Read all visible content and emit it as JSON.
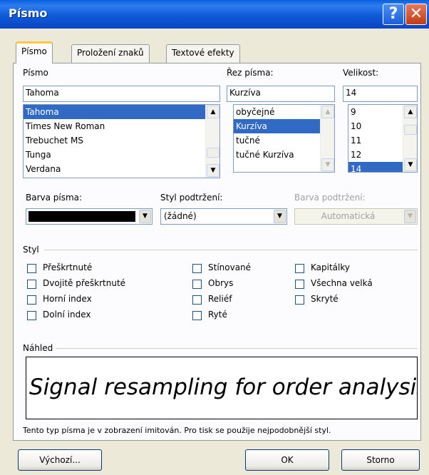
{
  "window": {
    "title": "Písmo"
  },
  "titlebar": {
    "help_glyph": "?",
    "close_glyph": "✕"
  },
  "tabs": [
    {
      "label": "Písmo"
    },
    {
      "label": "Proložení znaků"
    },
    {
      "label": "Textové efekty"
    }
  ],
  "font": {
    "label": "Písmo",
    "value": "Tahoma",
    "items": [
      "Tahoma",
      "Times New Roman",
      "Trebuchet MS",
      "Tunga",
      "Verdana"
    ],
    "selected": "Tahoma"
  },
  "style": {
    "label": "Řez písma:",
    "value": "Kurzíva",
    "items": [
      "obyčejné",
      "Kurzíva",
      "tučné",
      "tučné Kurzíva"
    ],
    "selected": "Kurzíva"
  },
  "size": {
    "label": "Velikost:",
    "value": "14",
    "items": [
      "9",
      "10",
      "11",
      "12",
      "14"
    ],
    "selected": "14"
  },
  "font_color": {
    "label": "Barva písma:",
    "value_color": "#000000"
  },
  "underline_style": {
    "label": "Styl podtržení:",
    "value": "(žádné)"
  },
  "underline_color": {
    "label": "Barva podtržení:",
    "value": "Automatická"
  },
  "effects": {
    "group_label": "Styl",
    "col1": [
      "Přeškrtnuté",
      "Dvojitě přeškrtnuté",
      "Horní index",
      "Dolní index"
    ],
    "col2": [
      "Stínované",
      "Obrys",
      "Reliéf",
      "Ryté"
    ],
    "col3": [
      "Kapitálky",
      "Všechna velká",
      "Skryté"
    ]
  },
  "preview": {
    "group_label": "Náhled",
    "text": "Signal resampling for order analysis and syn",
    "note": "Tento typ písma je v zobrazení imitován. Pro tisk se použije nejpodobnější styl."
  },
  "buttons": {
    "default": "Výchozí...",
    "ok": "OK",
    "cancel": "Storno"
  },
  "colors": {
    "titlebar": "#0a5fe0",
    "selection": "#316ac5",
    "dialog_bg": "#ece9d8"
  }
}
